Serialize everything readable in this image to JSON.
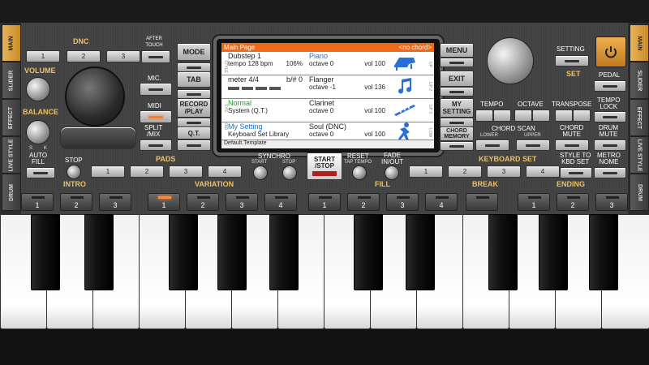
{
  "left_tabs": [
    "MAIN",
    "SLIDER",
    "EFFECT",
    "LIVE STYLE",
    "DRUM"
  ],
  "right_tabs": [
    "MAIN",
    "SLIDER",
    "EFFECT",
    "LIVE STYLE",
    "DRUM"
  ],
  "dnc": {
    "label": "DNC",
    "after_touch": "AFTER\nTOUCH",
    "buttons": [
      "1",
      "2",
      "3"
    ]
  },
  "volume_label": "VOLUME",
  "balance_label": "BALANCE",
  "balance_s": "S",
  "balance_k": "K",
  "left_buttons": {
    "mic": "MIC.",
    "midi": "MIDI",
    "split_mix": "SPLIT\n/MIX"
  },
  "center_left_buttons": {
    "mode": "MODE",
    "tab": "TAB",
    "record_play": "RECORD\n/PLAY",
    "qt": "Q.T."
  },
  "screen": {
    "title": "Main Page",
    "chord": "<no chord>",
    "style_name": "Dubstep 1",
    "tempo": "tempo 128 bpm",
    "tempo_pct": "106%",
    "meter": "meter 4/4",
    "bsharp": "b/# 0",
    "normal": "Normal",
    "system": "System (Q.T.)",
    "my_setting": "My Setting",
    "kbd_lib": "Keyboard Set Library",
    "voices": [
      {
        "name": "Piano",
        "octave": "octave 0",
        "vol": "vol 100"
      },
      {
        "name": "Flanger",
        "octave": "octave -1",
        "vol": "vol 136"
      },
      {
        "name": "Clarinet",
        "octave": "octave 0",
        "vol": "vol 100"
      },
      {
        "name": "Soul (DNC)",
        "octave": "octave 0",
        "vol": "vol 100"
      }
    ],
    "left_strip": [
      "STYLE",
      "SYS",
      "KBD"
    ],
    "right_strip": [
      "UP",
      "UP 2",
      "UP 3",
      "LOW"
    ],
    "footer": "Default.Template"
  },
  "right_menu": {
    "menu": "MENU",
    "exit": "EXIT",
    "my_setting": "MY\nSETTING",
    "chord_memory": "CHORD\nMEMORY"
  },
  "right_panel": {
    "setting": "SETTING",
    "set": "SET",
    "pedal": "PEDAL",
    "tempo": "TEMPO",
    "octave": "OCTAVE",
    "transpose": "TRANSPOSE",
    "tempo_lock": "TEMPO\nLOCK",
    "chord_scan": "CHORD SCAN",
    "lower": "LOWER",
    "upper": "UPPER",
    "chord_mute": "CHORD\nMUTE",
    "drum_mute": "DRUM\nMUTE"
  },
  "row2": {
    "auto_fill": "AUTO\nFILL",
    "stop": "STOP",
    "pads": "PADS",
    "pad_buttons": [
      "1",
      "2",
      "3",
      "4"
    ],
    "synchro": "SYNCHRO",
    "synchro_start": "START",
    "synchro_stop": "STOP",
    "start_stop": "START\n/STOP",
    "reset": "RESET",
    "tap_tempo": "TAP TEMPO",
    "fade": "FADE\nIN/OUT",
    "keyboard_set": "KEYBOARD SET",
    "kbd_buttons": [
      "1",
      "2",
      "3",
      "4"
    ],
    "style_to_kbd": "STYLE TO\nKBD SET",
    "metronome": "METRO\nNOME"
  },
  "row3": {
    "intro": "INTRO",
    "variation": "VARIATION",
    "fill": "FILL",
    "break": "BREAK",
    "ending": "ENDING",
    "intro_pads": [
      "1",
      "2",
      "3"
    ],
    "variation_pads": [
      "1",
      "2",
      "3",
      "4"
    ],
    "fill_pads": [
      "1",
      "2",
      "3",
      "4"
    ],
    "break_pad": "",
    "ending_pads": [
      "1",
      "2",
      "3"
    ]
  },
  "colors": {
    "accent": "#f0c060",
    "screen_title": "#f06a1a",
    "led": "#ff7a2a"
  }
}
